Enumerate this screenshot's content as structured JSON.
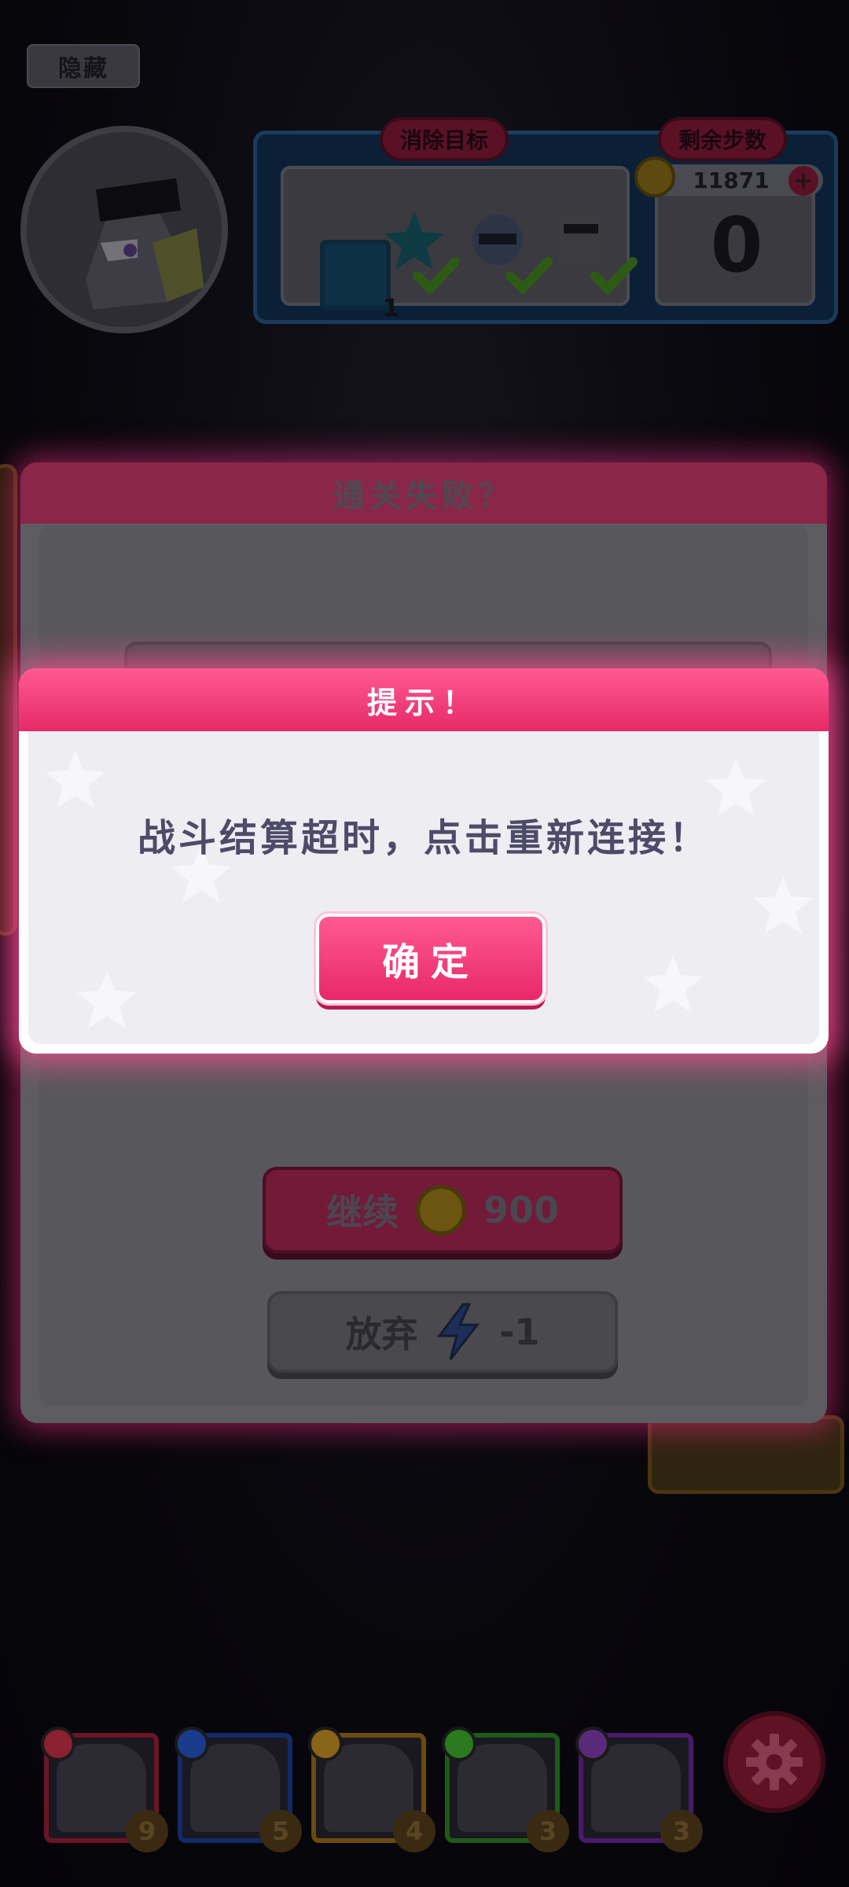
{
  "top": {
    "hide_label": "隐藏"
  },
  "goal_panel": {
    "goal_tab_label": "消除目标",
    "steps_tab_label": "剩余步数",
    "coins": "11871",
    "steps_remaining": "0",
    "tile_count": "1",
    "plus_symbol": "+"
  },
  "fail_dialog": {
    "title": "通关失败？",
    "continue_label": "继续",
    "continue_cost": "900",
    "giveup_label": "放弃",
    "giveup_cost": "-1"
  },
  "tip_dialog": {
    "title": "提示！",
    "message": "战斗结算超时，点击重新连接！",
    "confirm_label": "确定"
  },
  "team": [
    {
      "level": "9",
      "frame_color": "#6a1426",
      "icon_color": "#8a2030",
      "icon": "close-icon"
    },
    {
      "level": "5",
      "frame_color": "#132a66",
      "icon_color": "#1a3a8a",
      "icon": "arrows-horizontal-icon"
    },
    {
      "level": "4",
      "frame_color": "#6a4a10",
      "icon_color": "#8a6418",
      "icon": "arrows-vertical-icon"
    },
    {
      "level": "3",
      "frame_color": "#1f5a16",
      "icon_color": "#2a7a1e",
      "icon": "swirl-icon"
    },
    {
      "level": "3",
      "frame_color": "#4a1a6a",
      "icon_color": "#5a2a7a",
      "icon": "rocket-icon"
    }
  ],
  "colors": {
    "accent_pink": "#ff4a88",
    "dialog_white": "#ffffff",
    "text_dark": "#4d4b68"
  }
}
